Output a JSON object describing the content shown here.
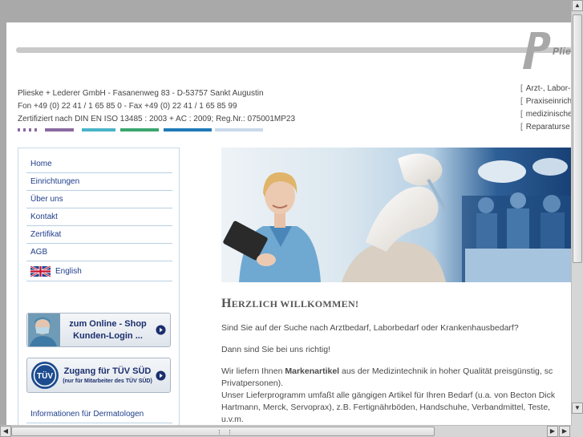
{
  "header": {
    "logo_text": "Pliesk",
    "company_lines": [
      "Plieske + Lederer GmbH - Fasanenweg 83 - D-53757 Sankt Augustin",
      "Fon +49 (0) 22 41 / 1 65 85 0 - Fax +49 (0) 22 41 / 1 65 85 99",
      "Zertifiziert nach DIN EN ISO 13485 : 2003 + AC : 2009; Reg.Nr.: 075001MP23"
    ],
    "services": [
      "Arzt-, Labor-",
      "Praxiseinrich",
      "medizinische",
      "Reparaturse"
    ],
    "bracket": "[",
    "stripe_colors": [
      "#8a6aa0",
      "#49b4c8",
      "#3aa66e",
      "#1e7ab8",
      "#c9d9ec"
    ]
  },
  "sidebar": {
    "nav": [
      {
        "label": "Home"
      },
      {
        "label": "Einrichtungen"
      },
      {
        "label": "Über uns"
      },
      {
        "label": "Kontakt"
      },
      {
        "label": "Zertifikat"
      },
      {
        "label": "AGB"
      },
      {
        "label": "English",
        "icon": "uk-flag-icon"
      }
    ],
    "shop_button": {
      "line1": "zum Online - Shop",
      "line2": "Kunden-Login ..."
    },
    "tuv_button": {
      "line1": "Zugang für TÜV SÜD",
      "line2": "(nur für Mitarbeiter des TÜV SÜD)",
      "logo_text": "TÜV"
    },
    "dermatologen_link": "Informationen für Dermatologen"
  },
  "main": {
    "welcome_first": "H",
    "welcome_rest": "ERZLICH WILLKOMMEN!",
    "p1": "Sind Sie auf der Suche nach Arztbedarf, Laborbedarf oder Krankenhausbedarf?",
    "p2": "Dann sind Sie bei uns richtig!",
    "p3_before": "Wir liefern Ihnen ",
    "p3_bold": "Markenartikel",
    "p3_after": " aus der Medizintechnik in hoher Qualität preisgünstig, sc",
    "p3_line2": "Privatpersonen).",
    "p4_line1": "Unser Lieferprogramm umfaßt alle gängigen Artikel für Ihren Bedarf (u.a. von Becton Dick",
    "p4_line2": "Hartmann, Merck, Servoprax), z.B. Fertignährböden, Handschuhe, Verbandmittel, Teste, ",
    "p4_line3": "u.v.m."
  }
}
